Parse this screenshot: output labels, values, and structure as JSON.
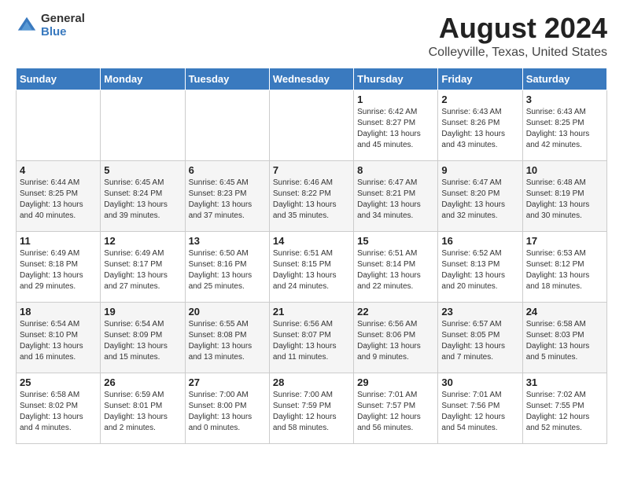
{
  "logo": {
    "general": "General",
    "blue": "Blue"
  },
  "title": "August 2024",
  "subtitle": "Colleyville, Texas, United States",
  "days_of_week": [
    "Sunday",
    "Monday",
    "Tuesday",
    "Wednesday",
    "Thursday",
    "Friday",
    "Saturday"
  ],
  "weeks": [
    [
      {
        "day": "",
        "info": ""
      },
      {
        "day": "",
        "info": ""
      },
      {
        "day": "",
        "info": ""
      },
      {
        "day": "",
        "info": ""
      },
      {
        "day": "1",
        "info": "Sunrise: 6:42 AM\nSunset: 8:27 PM\nDaylight: 13 hours\nand 45 minutes."
      },
      {
        "day": "2",
        "info": "Sunrise: 6:43 AM\nSunset: 8:26 PM\nDaylight: 13 hours\nand 43 minutes."
      },
      {
        "day": "3",
        "info": "Sunrise: 6:43 AM\nSunset: 8:25 PM\nDaylight: 13 hours\nand 42 minutes."
      }
    ],
    [
      {
        "day": "4",
        "info": "Sunrise: 6:44 AM\nSunset: 8:25 PM\nDaylight: 13 hours\nand 40 minutes."
      },
      {
        "day": "5",
        "info": "Sunrise: 6:45 AM\nSunset: 8:24 PM\nDaylight: 13 hours\nand 39 minutes."
      },
      {
        "day": "6",
        "info": "Sunrise: 6:45 AM\nSunset: 8:23 PM\nDaylight: 13 hours\nand 37 minutes."
      },
      {
        "day": "7",
        "info": "Sunrise: 6:46 AM\nSunset: 8:22 PM\nDaylight: 13 hours\nand 35 minutes."
      },
      {
        "day": "8",
        "info": "Sunrise: 6:47 AM\nSunset: 8:21 PM\nDaylight: 13 hours\nand 34 minutes."
      },
      {
        "day": "9",
        "info": "Sunrise: 6:47 AM\nSunset: 8:20 PM\nDaylight: 13 hours\nand 32 minutes."
      },
      {
        "day": "10",
        "info": "Sunrise: 6:48 AM\nSunset: 8:19 PM\nDaylight: 13 hours\nand 30 minutes."
      }
    ],
    [
      {
        "day": "11",
        "info": "Sunrise: 6:49 AM\nSunset: 8:18 PM\nDaylight: 13 hours\nand 29 minutes."
      },
      {
        "day": "12",
        "info": "Sunrise: 6:49 AM\nSunset: 8:17 PM\nDaylight: 13 hours\nand 27 minutes."
      },
      {
        "day": "13",
        "info": "Sunrise: 6:50 AM\nSunset: 8:16 PM\nDaylight: 13 hours\nand 25 minutes."
      },
      {
        "day": "14",
        "info": "Sunrise: 6:51 AM\nSunset: 8:15 PM\nDaylight: 13 hours\nand 24 minutes."
      },
      {
        "day": "15",
        "info": "Sunrise: 6:51 AM\nSunset: 8:14 PM\nDaylight: 13 hours\nand 22 minutes."
      },
      {
        "day": "16",
        "info": "Sunrise: 6:52 AM\nSunset: 8:13 PM\nDaylight: 13 hours\nand 20 minutes."
      },
      {
        "day": "17",
        "info": "Sunrise: 6:53 AM\nSunset: 8:12 PM\nDaylight: 13 hours\nand 18 minutes."
      }
    ],
    [
      {
        "day": "18",
        "info": "Sunrise: 6:54 AM\nSunset: 8:10 PM\nDaylight: 13 hours\nand 16 minutes."
      },
      {
        "day": "19",
        "info": "Sunrise: 6:54 AM\nSunset: 8:09 PM\nDaylight: 13 hours\nand 15 minutes."
      },
      {
        "day": "20",
        "info": "Sunrise: 6:55 AM\nSunset: 8:08 PM\nDaylight: 13 hours\nand 13 minutes."
      },
      {
        "day": "21",
        "info": "Sunrise: 6:56 AM\nSunset: 8:07 PM\nDaylight: 13 hours\nand 11 minutes."
      },
      {
        "day": "22",
        "info": "Sunrise: 6:56 AM\nSunset: 8:06 PM\nDaylight: 13 hours\nand 9 minutes."
      },
      {
        "day": "23",
        "info": "Sunrise: 6:57 AM\nSunset: 8:05 PM\nDaylight: 13 hours\nand 7 minutes."
      },
      {
        "day": "24",
        "info": "Sunrise: 6:58 AM\nSunset: 8:03 PM\nDaylight: 13 hours\nand 5 minutes."
      }
    ],
    [
      {
        "day": "25",
        "info": "Sunrise: 6:58 AM\nSunset: 8:02 PM\nDaylight: 13 hours\nand 4 minutes."
      },
      {
        "day": "26",
        "info": "Sunrise: 6:59 AM\nSunset: 8:01 PM\nDaylight: 13 hours\nand 2 minutes."
      },
      {
        "day": "27",
        "info": "Sunrise: 7:00 AM\nSunset: 8:00 PM\nDaylight: 13 hours\nand 0 minutes."
      },
      {
        "day": "28",
        "info": "Sunrise: 7:00 AM\nSunset: 7:59 PM\nDaylight: 12 hours\nand 58 minutes."
      },
      {
        "day": "29",
        "info": "Sunrise: 7:01 AM\nSunset: 7:57 PM\nDaylight: 12 hours\nand 56 minutes."
      },
      {
        "day": "30",
        "info": "Sunrise: 7:01 AM\nSunset: 7:56 PM\nDaylight: 12 hours\nand 54 minutes."
      },
      {
        "day": "31",
        "info": "Sunrise: 7:02 AM\nSunset: 7:55 PM\nDaylight: 12 hours\nand 52 minutes."
      }
    ]
  ]
}
